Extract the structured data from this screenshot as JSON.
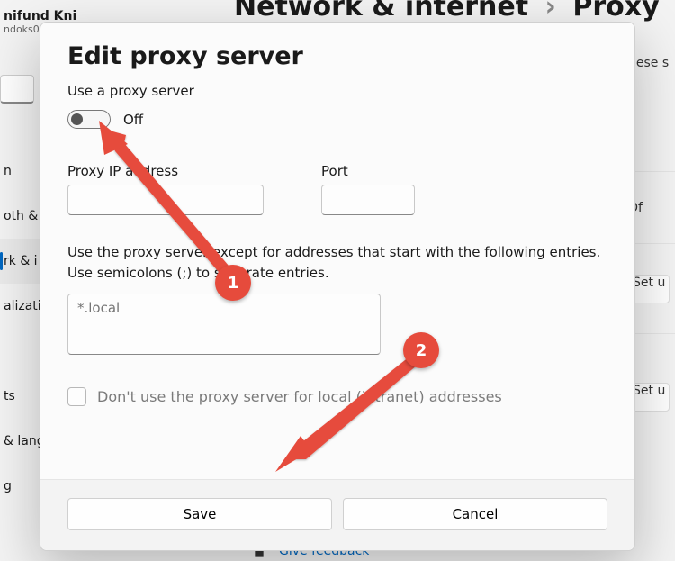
{
  "breadcrumb": {
    "parent": "Network & internet",
    "current": "Proxy"
  },
  "user": {
    "name": "nifund  Kni",
    "email": "ndoks0"
  },
  "sidebar": {
    "items": [
      {
        "label": "n"
      },
      {
        "label": "oth &"
      },
      {
        "label": "rk & i"
      },
      {
        "label": "alizatio"
      },
      {
        "label": "ts"
      },
      {
        "label": "& lang"
      },
      {
        "label": "g"
      }
    ],
    "selected_index": 2
  },
  "right_hints": {
    "partial_text": "hese s",
    "row1": "Of",
    "row2": "Set u",
    "row3": "Set u"
  },
  "feedback": {
    "label": "Give feedback"
  },
  "dialog": {
    "title": "Edit proxy server",
    "use_proxy_label": "Use a proxy server",
    "toggle_state": "Off",
    "ip_label": "Proxy IP address",
    "ip_value": "",
    "port_label": "Port",
    "port_value": "",
    "exceptions_help": "Use the proxy server except for addresses that start with the following entries. Use semicolons (;) to separate entries.",
    "exceptions_placeholder": "*.local",
    "exceptions_value": "",
    "bypass_local_label": "Don't use the proxy server for local (intranet) addresses",
    "bypass_local_checked": false,
    "save_label": "Save",
    "cancel_label": "Cancel"
  },
  "annotations": {
    "badge1": "1",
    "badge2": "2"
  }
}
